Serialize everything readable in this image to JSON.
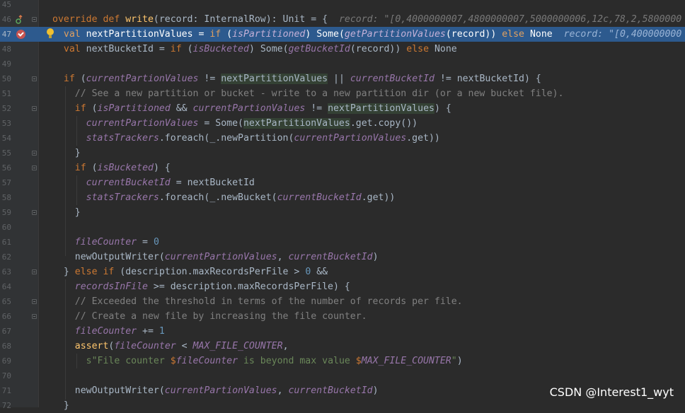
{
  "editor": {
    "lines": [
      {
        "n": "45",
        "html": ""
      },
      {
        "n": "46",
        "html": "<span class=\"kw\">override def </span><span class=\"fn\">write</span>(record: InternalRow): Unit = {  <span class=\"hint\">record: \"[0,4000000007,4800000007,5000000006,12c,78,2,5800000</span>",
        "fold": true,
        "icon": "override"
      },
      {
        "n": "47",
        "html": "  <span class=\"kw\">val </span>nextPartitionValues = <span class=\"kw\">if </span>(<span class=\"it\">isPartitioned</span>) Some(<span class=\"it\">getPartitionValues</span>(record)) <span class=\"kw\">else </span>None  <span class=\"hint\">record: \"[0,400000000</span>",
        "current": true,
        "icon": "breakpoint",
        "bulb": true
      },
      {
        "n": "48",
        "html": "  <span class=\"kw\">val </span>nextBucketId = <span class=\"kw\">if </span>(<span class=\"it\">isBucketed</span>) Some(<span class=\"it\">getBucketId</span>(record)) <span class=\"kw\">else </span>None"
      },
      {
        "n": "49",
        "html": ""
      },
      {
        "n": "50",
        "html": "  <span class=\"kw\">if </span>(<span class=\"it\">currentPartionValues </span>!= <span class=\"hl\">nextPartitionValues</span> || <span class=\"it\">currentBucketId </span>!= nextBucketId) {",
        "fold": true
      },
      {
        "n": "51",
        "html": "    <span class=\"cm\">// See a new partition or bucket - write to a new partition dir (or a new bucket file).</span>"
      },
      {
        "n": "52",
        "html": "    <span class=\"kw\">if </span>(<span class=\"it\">isPartitioned </span>&amp;&amp; <span class=\"it\">currentPartionValues </span>!= <span class=\"hl\">nextPartitionValues</span>) {",
        "fold": true
      },
      {
        "n": "53",
        "html": "      <span class=\"it\">currentPartionValues </span>= Some(<span class=\"hl\">nextPartitionValues</span>.get.copy())"
      },
      {
        "n": "54",
        "html": "      <span class=\"it\">statsTrackers</span>.foreach(_.newPartition(<span class=\"it\">currentPartionValues</span>.get))"
      },
      {
        "n": "55",
        "html": "    }",
        "fold": true
      },
      {
        "n": "56",
        "html": "    <span class=\"kw\">if </span>(<span class=\"it\">isBucketed</span>) {",
        "fold": true
      },
      {
        "n": "57",
        "html": "      <span class=\"it\">currentBucketId </span>= nextBucketId"
      },
      {
        "n": "58",
        "html": "      <span class=\"it\">statsTrackers</span>.foreach(_.newBucket(<span class=\"it\">currentBucketId</span>.get))"
      },
      {
        "n": "59",
        "html": "    }",
        "fold": true
      },
      {
        "n": "60",
        "html": ""
      },
      {
        "n": "61",
        "html": "    <span class=\"it\">fileCounter </span>= <span class=\"num\">0</span>"
      },
      {
        "n": "62",
        "html": "    newOutputWriter(<span class=\"it\">currentPartionValues</span>, <span class=\"it\">currentBucketId</span>)"
      },
      {
        "n": "63",
        "html": "  } <span class=\"kw\">else if </span>(description.maxRecordsPerFile &gt; <span class=\"num\">0 </span>&amp;&amp;",
        "fold": true
      },
      {
        "n": "64",
        "html": "    <span class=\"it\">recordsInFile </span>&gt;= description.maxRecordsPerFile) {"
      },
      {
        "n": "65",
        "html": "    <span class=\"cm\">// Exceeded the threshold in terms of the number of records per file.</span>",
        "fold": true
      },
      {
        "n": "66",
        "html": "    <span class=\"cm\">// Create a new file by increasing the file counter.</span>",
        "fold": true
      },
      {
        "n": "67",
        "html": "    <span class=\"it\">fileCounter </span>+= <span class=\"num\">1</span>"
      },
      {
        "n": "68",
        "html": "    <span class=\"fn\">assert</span>(<span class=\"it\">fileCounter </span>&lt; <span class=\"it\">MAX_FILE_COUNTER</span>,"
      },
      {
        "n": "69",
        "html": "      <span class=\"str\">s\"File counter </span><span class=\"kw\">$</span><span class=\"it\">fileCounter</span><span class=\"str\"> is beyond max value </span><span class=\"kw\">$</span><span class=\"it\">MAX_FILE_COUNTER</span><span class=\"str\">\"</span>)"
      },
      {
        "n": "70",
        "html": ""
      },
      {
        "n": "71",
        "html": "    newOutputWriter(<span class=\"it\">currentPartionValues</span>, <span class=\"it\">currentBucketId</span>)"
      },
      {
        "n": "72",
        "html": "  }"
      }
    ]
  },
  "watermark": "CSDN @Interest1_wyt"
}
